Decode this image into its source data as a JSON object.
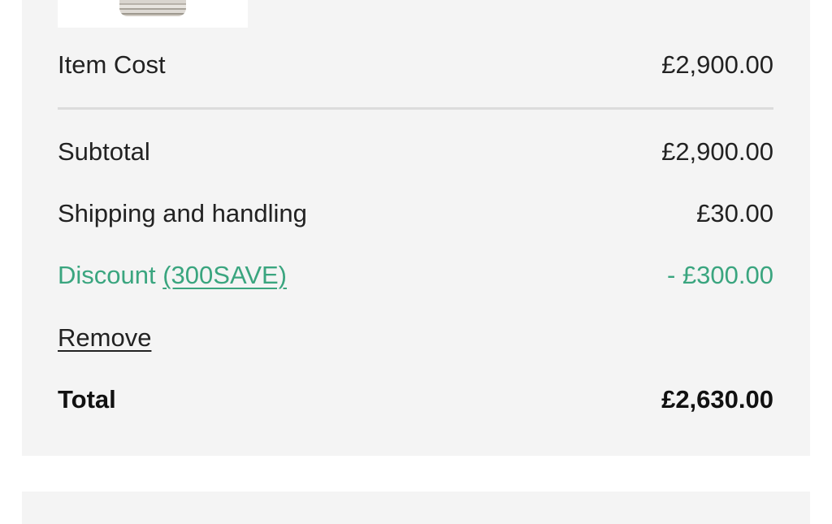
{
  "summary": {
    "item_cost_label": "Item Cost",
    "item_cost_value": "£2,900.00",
    "subtotal_label": "Subtotal",
    "subtotal_value": "£2,900.00",
    "shipping_label": "Shipping and handling",
    "shipping_value": "£30.00",
    "discount_label": "Discount",
    "discount_code": "(300SAVE)",
    "discount_value": "- £300.00",
    "remove_label": "Remove",
    "total_label": "Total",
    "total_value": "£2,630.00"
  },
  "colors": {
    "panel_background": "#f4f4f4",
    "discount_green": "#3aa57f",
    "text": "#222222"
  }
}
